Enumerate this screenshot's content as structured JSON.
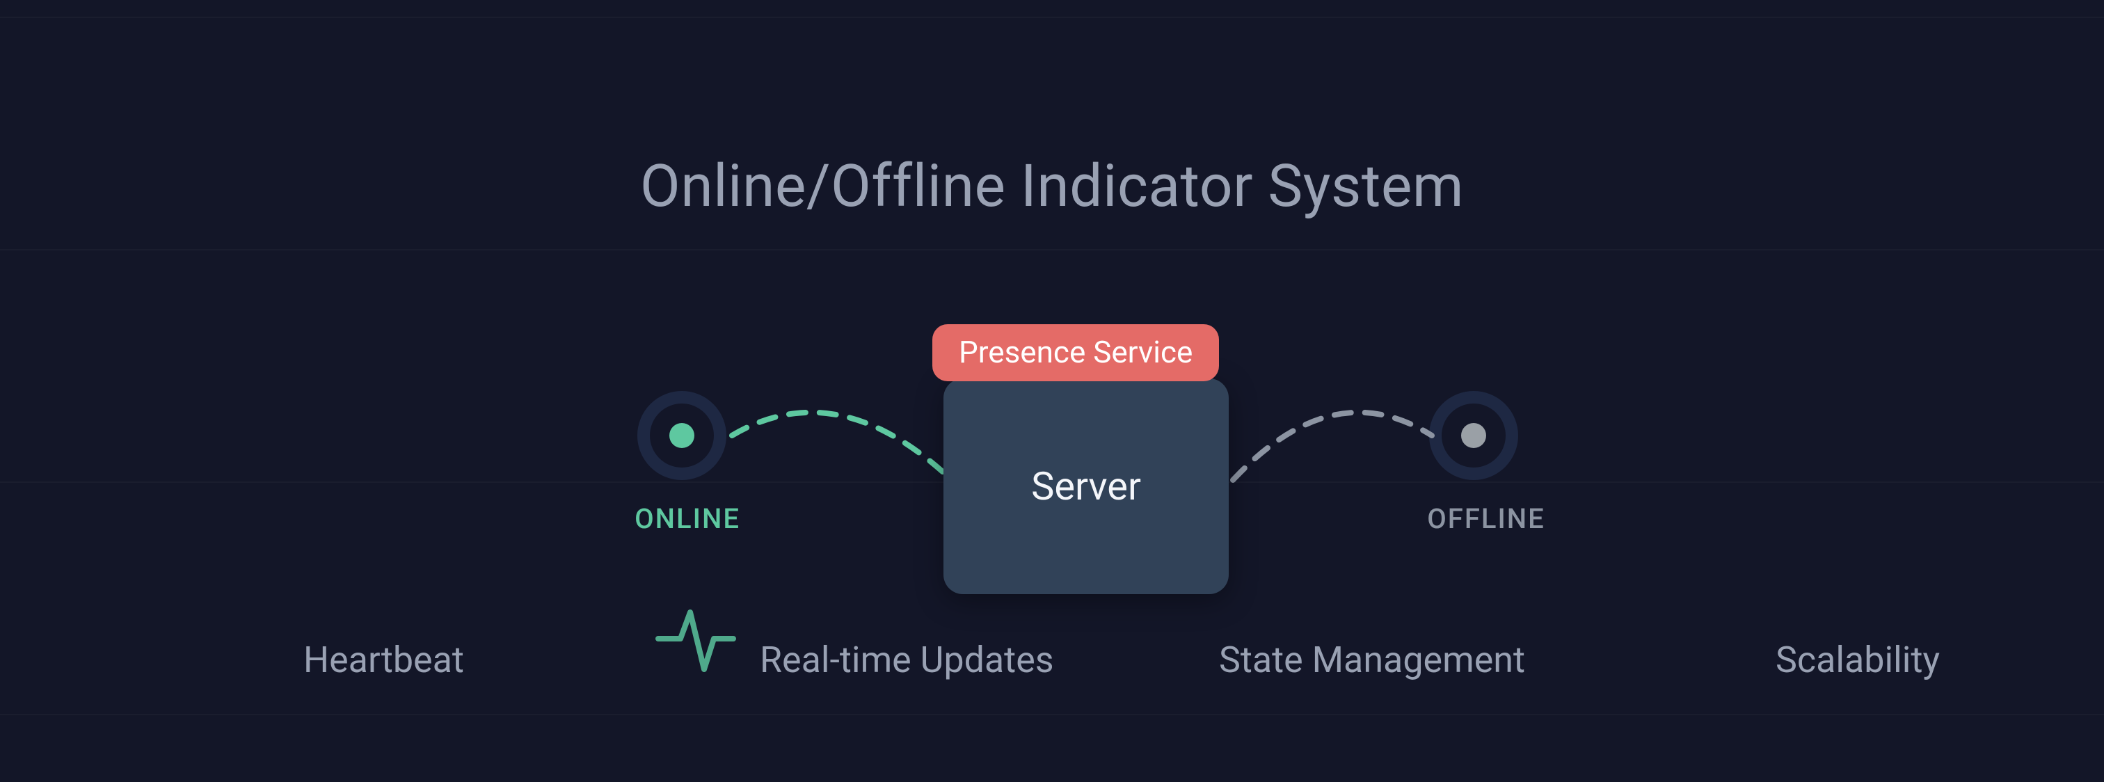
{
  "title": "Online/Offline Indicator System",
  "server": {
    "label": "Server"
  },
  "badge": {
    "label": "Presence Service"
  },
  "indicators": {
    "online": "ONLINE",
    "offline": "OFFLINE"
  },
  "footer": {
    "w0": "Heartbeat",
    "w1": "Real-time Updates",
    "w2": "State Management",
    "w3": "Scalability"
  },
  "colors": {
    "online": "#5ec8a0",
    "offline": "#8c94a2",
    "accent_red": "#e46b67",
    "server_fill": "#314258",
    "bg": "#131628"
  }
}
